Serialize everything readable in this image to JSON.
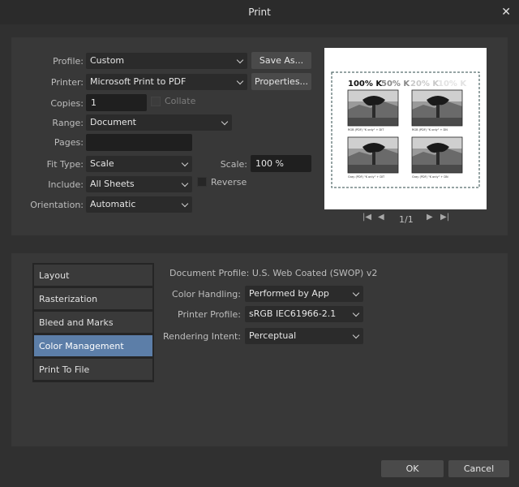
{
  "window": {
    "title": "Print"
  },
  "settings": {
    "profile": {
      "label": "Profile:",
      "value": "Custom"
    },
    "save_as": "Save As...",
    "printer": {
      "label": "Printer:",
      "value": "Microsoft Print to PDF"
    },
    "properties": "Properties...",
    "copies": {
      "label": "Copies:",
      "value": "1"
    },
    "collate": "Collate",
    "range": {
      "label": "Range:",
      "value": "Document"
    },
    "pages": {
      "label": "Pages:",
      "value": ""
    },
    "fit_type": {
      "label": "Fit Type:",
      "value": "Scale"
    },
    "scale": {
      "label": "Scale:",
      "value": "100 %"
    },
    "include": {
      "label": "Include:",
      "value": "All Sheets"
    },
    "reverse": "Reverse",
    "orientation": {
      "label": "Orientation:",
      "value": "Automatic"
    }
  },
  "preview": {
    "tones": [
      "100% K",
      "50% K",
      "20% K",
      "10% K"
    ],
    "captions": [
      "RGB (PDF) \"K only\" + DIT",
      "RGB (PDF) \"K only\" + DN",
      "Gray (PDF) \"K only\" + DIT",
      "Gray (PDF) \"K only\" + DN"
    ],
    "page_indicator": "1/1"
  },
  "sidebar": {
    "items": [
      "Layout",
      "Rasterization",
      "Bleed and Marks",
      "Color Management",
      "Print To File"
    ],
    "active": "Color Management"
  },
  "color_management": {
    "document_profile": "Document Profile: U.S. Web Coated (SWOP) v2",
    "color_handling": {
      "label": "Color Handling:",
      "value": "Performed by App"
    },
    "printer_profile": {
      "label": "Printer Profile:",
      "value": "sRGB IEC61966-2.1"
    },
    "rendering_intent": {
      "label": "Rendering Intent:",
      "value": "Perceptual"
    }
  },
  "footer": {
    "ok": "OK",
    "cancel": "Cancel"
  },
  "colors": {
    "background": "#303030",
    "panel": "#383838",
    "accent": "#5c7ea8",
    "field": "#1f1f1f"
  }
}
